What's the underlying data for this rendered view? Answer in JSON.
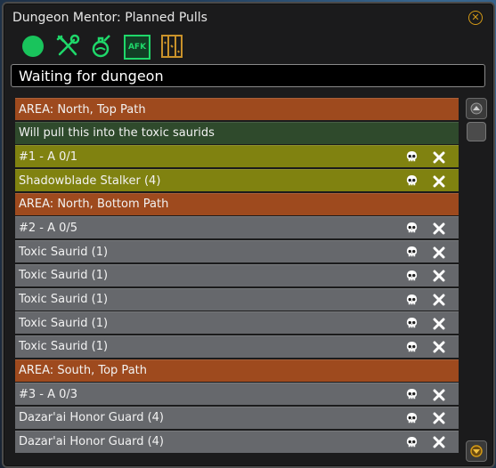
{
  "window": {
    "title": "Dungeon Mentor: Planned Pulls"
  },
  "toolbar": {
    "icons": [
      "circle-icon",
      "tools-icon",
      "potion-icon",
      "afk-icon",
      "map-icon"
    ],
    "afk_label": "AFK"
  },
  "status": {
    "text": "Waiting for dungeon"
  },
  "rows": [
    {
      "kind": "area",
      "label": "AREA: North, Top Path"
    },
    {
      "kind": "note",
      "label": "Will pull this into the toxic saurids"
    },
    {
      "kind": "pull-active",
      "label": "#1 - A 0/1",
      "actions": true
    },
    {
      "kind": "unit-active",
      "label": "Shadowblade Stalker (4)",
      "actions": true
    },
    {
      "kind": "area",
      "label": "AREA: North, Bottom Path"
    },
    {
      "kind": "pull",
      "label": "#2 - A 0/5",
      "actions": true
    },
    {
      "kind": "unit",
      "label": "Toxic Saurid (1)",
      "actions": true
    },
    {
      "kind": "unit",
      "label": "Toxic Saurid (1)",
      "actions": true
    },
    {
      "kind": "unit",
      "label": "Toxic Saurid (1)",
      "actions": true
    },
    {
      "kind": "unit",
      "label": "Toxic Saurid (1)",
      "actions": true
    },
    {
      "kind": "unit",
      "label": "Toxic Saurid (1)",
      "actions": true
    },
    {
      "kind": "area",
      "label": "AREA: South, Top Path"
    },
    {
      "kind": "pull",
      "label": "#3 - A 0/3",
      "actions": true
    },
    {
      "kind": "unit",
      "label": "Dazar'ai Honor Guard (4)",
      "actions": true
    },
    {
      "kind": "unit",
      "label": "Dazar'ai Honor Guard (4)",
      "actions": true
    }
  ],
  "colors": {
    "area": "#9e4a1e",
    "note": "#2f4a2c",
    "active": "#808210",
    "pull": "#66686c",
    "accent_green": "#1fd86a",
    "close_gold": "#d49a16"
  }
}
